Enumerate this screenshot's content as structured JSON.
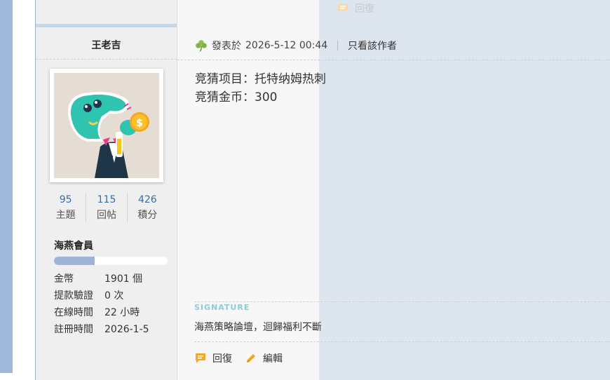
{
  "top": {
    "reply_label": "回復"
  },
  "user": {
    "name": "王老吉",
    "stats": [
      {
        "num": "95",
        "label": "主題"
      },
      {
        "num": "115",
        "label": "回帖"
      },
      {
        "num": "426",
        "label": "積分"
      }
    ],
    "rank": "海燕會員",
    "rank_progress": 0.36,
    "info": [
      {
        "k": "金幣",
        "v": "1901 個"
      },
      {
        "k": "提款驗證",
        "v": "0 次"
      },
      {
        "k": "在線時間",
        "v": "22 小時"
      },
      {
        "k": "註冊時間",
        "v": "2026-1-5"
      }
    ]
  },
  "post": {
    "meta_prefix": "發表於",
    "date": "2026-5-12 00:44",
    "author_only": "只看該作者",
    "lines": [
      "竞猜项目：托特纳姆热刺",
      "竞猜金币：300"
    ],
    "signature_label": "SIGNATURE",
    "signature": "海燕策略論壇，迴歸福利不斷"
  },
  "actions": {
    "reply": "回復",
    "edit": "編輯"
  },
  "colors": {
    "accent_orange": "#f5a623",
    "link_blue": "#3a6ea5",
    "clover_green": "#7cb342"
  }
}
